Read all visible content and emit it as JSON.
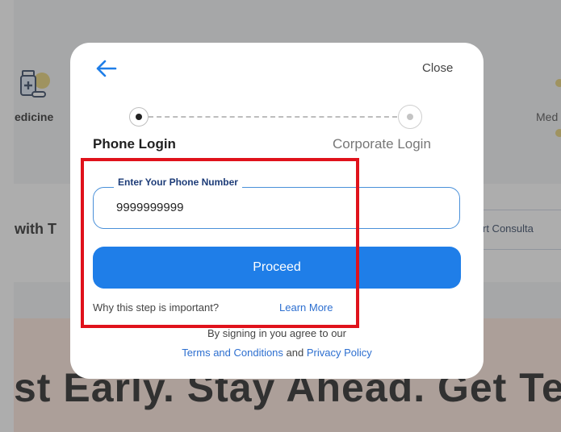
{
  "background": {
    "medicine_label": "edicine",
    "medicine_right_label": "Med",
    "section_label": "with T",
    "consult_label": "rt Consulta",
    "headline": "st Early. Stay Ahead. Get Tested"
  },
  "modal": {
    "close_label": "Close",
    "steps": {
      "step1": "Phone Login",
      "step2": "Corporate Login"
    },
    "phone_field": {
      "label": "Enter Your Phone Number",
      "value": "9999999999"
    },
    "proceed_label": "Proceed",
    "why_text": "Why this step is important?",
    "learn_more": "Learn More",
    "sign_text": "By signing in you agree to our",
    "terms_label": "Terms and Conditions",
    "and_text": "and",
    "privacy_label": "Privacy Policy"
  },
  "colors": {
    "accent": "#1f7ee8",
    "link": "#2d6fd0",
    "highlight": "#e0121b"
  }
}
